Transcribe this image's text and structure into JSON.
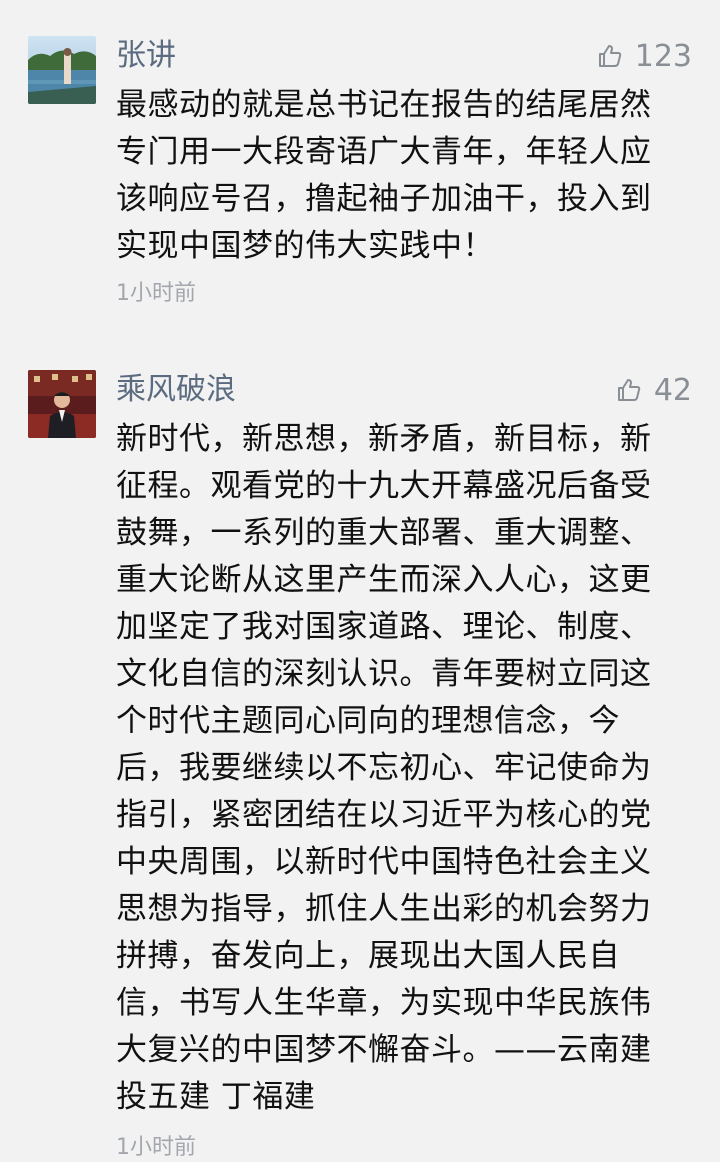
{
  "comments": [
    {
      "author": "张讲",
      "likes": "123",
      "lines": [
        "最感动的就是总书记在报告的结尾居然",
        "专门用一大段寄语广大青年，年轻人应",
        "该响应号召，撸起袖子加油干，投入到",
        "实现中国梦的伟大实践中！"
      ],
      "time": "1小时前",
      "avatar_icon": "landscape-photo-avatar"
    },
    {
      "author": "乘风破浪",
      "likes": "42",
      "lines": [
        "新时代，新思想，新矛盾，新目标，新",
        "征程。观看党的十九大开幕盛况后备受",
        "鼓舞，一系列的重大部署、重大调整、",
        "重大论断从这里产生而深入人心，这更",
        "加坚定了我对国家道路、理论、制度、",
        "文化自信的深刻认识。青年要树立同这",
        "个时代主题同心同向的理想信念，今",
        "后，我要继续以不忘初心、牢记使命为",
        "指引，紧密团结在以习近平为核心的党",
        "中央周围，以新时代中国特色社会主义",
        "思想为指导，抓住人生出彩的机会努力",
        "拼搏，奋发向上，展现出大国人民自",
        "信，书写人生华章，为实现中华民族伟",
        "大复兴的中国梦不懈奋斗。——云南建",
        "投五建 丁福建"
      ],
      "time": "1小时前",
      "avatar_icon": "portrait-photo-avatar"
    }
  ],
  "colors": {
    "background": "#f2f2f2",
    "author": "#5b6b80",
    "meta": "#a3a7ad",
    "text": "#111111"
  }
}
